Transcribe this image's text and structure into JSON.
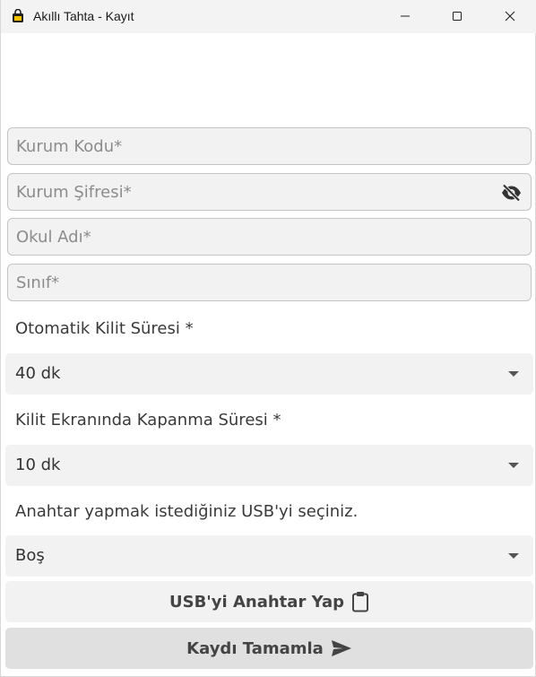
{
  "window": {
    "title": "Akıllı Tahta - Kayıt",
    "icons": {
      "app": "app-logo-icon",
      "minimize": "minimize-icon",
      "maximize": "maximize-icon",
      "close": "close-icon"
    }
  },
  "form": {
    "kurum_kodu": {
      "placeholder": "Kurum Kodu*",
      "value": ""
    },
    "kurum_sifresi": {
      "placeholder": "Kurum Şifresi*",
      "value": "",
      "icon": "eye-slash-icon"
    },
    "okul_adi": {
      "placeholder": "Okul Adı*",
      "value": ""
    },
    "sinif": {
      "placeholder": "Sınıf*",
      "value": ""
    },
    "kilit_suresi": {
      "label": "Otomatik Kilit Süresi *",
      "selected": "40 dk"
    },
    "kapanma_suresi": {
      "label": "Kilit Ekranında Kapanma Süresi *",
      "selected": "10 dk"
    },
    "usb": {
      "label": "Anahtar yapmak istediğiniz USB'yi seçiniz.",
      "selected": "Boş"
    }
  },
  "actions": {
    "make_key": {
      "label": "USB'yi Anahtar Yap",
      "icon": "clipboard-icon"
    },
    "complete": {
      "label": "Kaydı Tamamla",
      "icon": "send-icon"
    }
  },
  "colors": {
    "titlebar": "#f3f3f3",
    "field_bg": "#f2f2f2",
    "field_border": "#c4c4c4",
    "primary_button_bg": "#e0e0e0",
    "text": "#333333"
  }
}
